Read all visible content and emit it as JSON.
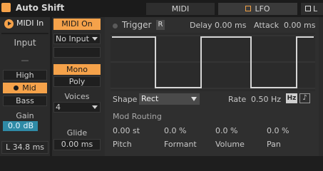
{
  "title": "Auto Shift",
  "tabs": {
    "midi": "MIDI",
    "lfo": "LFO",
    "more": "L"
  },
  "left": {
    "midi_in": "MIDI In",
    "input_label": "Input",
    "input_dash": "—",
    "high": "High",
    "mid": "Mid",
    "bass": "Bass",
    "gain_label": "Gain",
    "gain_value": "0.0",
    "gain_unit": "dB",
    "latency": "L 34.8 ms"
  },
  "middle": {
    "midi_on": "MIDI On",
    "no_input": "No Input",
    "mono": "Mono",
    "poly": "Poly",
    "voices_label": "Voices",
    "voices_value": "4",
    "glide_label": "Glide",
    "glide_value": "0.00 ms"
  },
  "lfo": {
    "trigger_label": "Trigger",
    "trigger_button": "R",
    "delay_label": "Delay",
    "delay_value": "0.00 ms",
    "attack_label": "Attack",
    "attack_value": "0.00 ms",
    "shape_label": "Shape",
    "shape_value": "Rect",
    "rate_label": "Rate",
    "rate_value": "0.50 Hz",
    "hz_button": "Hz",
    "note_button": "♪",
    "mod_routing_label": "Mod Routing",
    "mod": [
      {
        "value": "0.00 st",
        "label": "Pitch"
      },
      {
        "value": "0.0 %",
        "label": "Formant"
      },
      {
        "value": "0.0 %",
        "label": "Volume"
      },
      {
        "value": "0.0 %",
        "label": "Pan"
      }
    ]
  },
  "colors": {
    "accent": "#f5a24a",
    "gain_field": "#2f8aa6",
    "background": "#2b2b2b"
  }
}
